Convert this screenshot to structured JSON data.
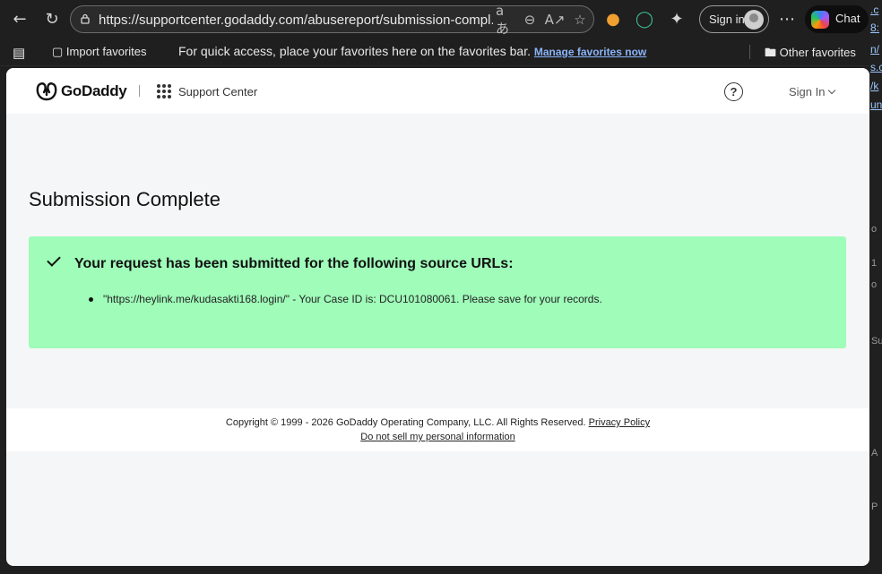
{
  "browser": {
    "url": "https://supportcenter.godaddy.com/abusereport/submission-compl...",
    "signin_label": "Sign in",
    "chat_label": "Chat",
    "favorites_bar": {
      "import_label": "Import favorites",
      "hint_text": "For quick access, place your favorites here on the favorites bar.",
      "manage_link": "Manage favorites now",
      "other_label": "Other favorites"
    },
    "background_window_fragments": [
      ".c",
      "8:",
      "n/",
      "s.c",
      "/k",
      "un",
      "o",
      "1",
      "o",
      "Su",
      "A",
      "P"
    ]
  },
  "site": {
    "brand": "GoDaddy",
    "section": "Support Center",
    "signin_label": "Sign In",
    "help_glyph": "?",
    "brand_color": "#111111"
  },
  "main": {
    "title": "Submission Complete",
    "alert": {
      "color": "#9ffcb9",
      "heading": "Your request has been submitted for the following source URLs:",
      "items": [
        "\"https://heylink.me/kudasakti168.login/\" - Your Case ID is: DCU101080061. Please save for your records."
      ]
    }
  },
  "footer": {
    "copyright": "Copyright © 1999 - 2026 GoDaddy Operating Company, LLC. All Rights Reserved.",
    "privacy_link": "Privacy Policy",
    "do_not_sell_link": "Do not sell my personal information"
  }
}
